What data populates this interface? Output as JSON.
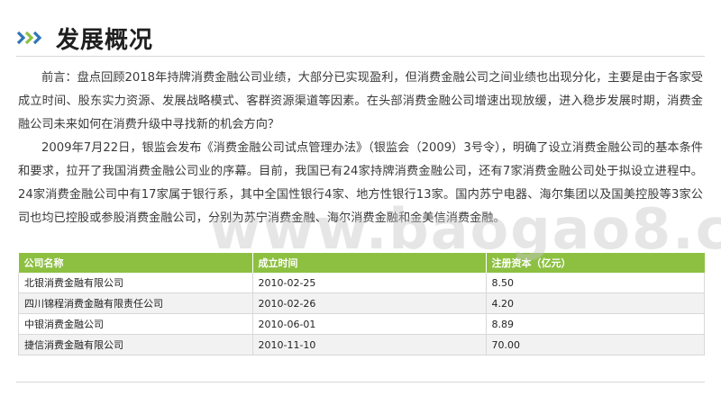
{
  "header": {
    "title": "发展概况",
    "icon": "triple-chevron-right-icon",
    "chevron_colors": [
      "#2e75b6",
      "#8dc041",
      "#2e75b6"
    ]
  },
  "body": {
    "paragraphs": [
      "前言：盘点回顾2018年持牌消费金融公司业绩，大部分已实现盈利，但消费金融公司之间业绩也出现分化，主要是由于各家受成立时间、股东实力资源、发展战略模式、客群资源渠道等因素。在头部消费金融公司增速出现放缓，进入稳步发展时期，消费金融公司未来如何在消费升级中寻找新的机会方向？",
      "2009年7月22日，银监会发布《消费金融公司试点管理办法》（银监会（2009）3号令），明确了设立消费金融公司的基本条件和要求，拉开了我国消费金融公司业的序幕。目前，我国已有24家持牌消费金融公司，还有7家消费金融公司处于拟设立进程中。24家消费金融公司中有17家属于银行系，其中全国性银行4家、地方性银行13家。国内苏宁电器、海尔集团以及国美控股等3家公司也均已控股或参股消费金融公司，分别为苏宁消费金融、海尔消费金融和金美信消费金融。"
    ]
  },
  "watermark": "www.baogao8.com",
  "table": {
    "header_color": "#8dc041",
    "columns": [
      "公司名称",
      "成立时间",
      "注册资本（亿元）"
    ],
    "rows": [
      [
        "北银消费金融有限公司",
        "2010-02-25",
        "8.50"
      ],
      [
        "四川锦程消费金融有限责任公司",
        "2010-02-26",
        "4.20"
      ],
      [
        "中银消费金融公司",
        "2010-06-01",
        "8.89"
      ],
      [
        "捷信消费金融有限公司",
        "2010-11-10",
        "70.00"
      ]
    ]
  }
}
